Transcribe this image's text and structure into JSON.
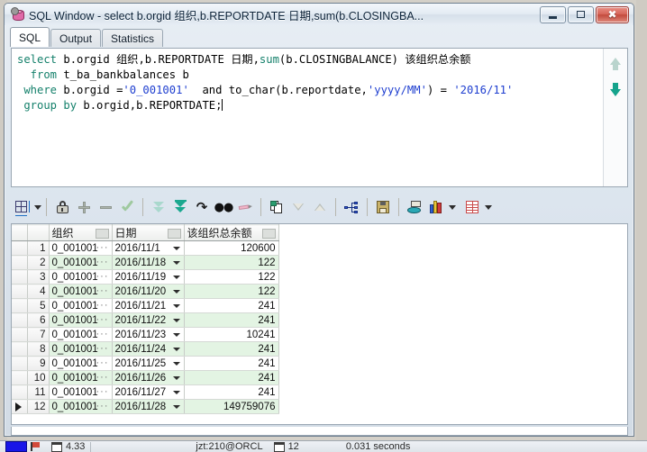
{
  "window": {
    "title": "SQL Window - select b.orgid 组织,b.REPORTDATE 日期,sum(b.CLOSINGBA...",
    "app_icon": "database-icon",
    "buttons": {
      "minimize": "minimize-icon",
      "maximize": "maximize-icon",
      "close": "close-icon"
    }
  },
  "tabs": [
    {
      "label": "SQL",
      "active": true
    },
    {
      "label": "Output",
      "active": false
    },
    {
      "label": "Statistics",
      "active": false
    }
  ],
  "editor": {
    "lines": [
      "select b.orgid 组织,b.REPORTDATE 日期,sum(b.CLOSINGBALANCE) 该组织总余额",
      "  from t_ba_bankbalances b",
      " where b.orgid ='0_001001'  and to_char(b.reportdate,'yyyy/MM') = '2016/11'",
      " group by b.orgid,b.REPORTDATE;"
    ],
    "tokens": {
      "l1_select": "select",
      "l1_a": " b.orgid ",
      "l1_cjk1": "组织",
      "l1_b": ",b.REPORTDATE ",
      "l1_cjk2": "日期",
      "l1_c": ",",
      "l1_sum": "sum",
      "l1_d": "(b.CLOSINGBALANCE) ",
      "l1_cjk3": "该组织总余额",
      "l2_from": "  from",
      "l2_a": " t_ba_bankbalances b",
      "l3_where": " where",
      "l3_a": " b.orgid =",
      "l3_s1": "'0_001001'",
      "l3_b": "  and to_char(b.reportdate,",
      "l3_s2": "'yyyy/MM'",
      "l3_c": ") = ",
      "l3_s3": "'2016/11'",
      "l4_group": " group by",
      "l4_a": " b.orgid,b.REPORTDATE;"
    },
    "scroll_up_icon": "scroll-up-arrow-icon",
    "scroll_down_icon": "scroll-down-arrow-icon"
  },
  "toolbar": {
    "items": [
      {
        "name": "grid-layout-button",
        "icon": "grid-icon",
        "has_dropdown": true,
        "enabled": true
      },
      {
        "name": "lock-record-button",
        "icon": "lock-icon",
        "enabled": true
      },
      {
        "name": "insert-record-button",
        "icon": "plus-icon",
        "enabled": false
      },
      {
        "name": "delete-record-button",
        "icon": "minus-icon",
        "enabled": false
      },
      {
        "name": "post-changes-button",
        "icon": "check-icon",
        "enabled": false
      },
      {
        "name": "fetch-all-rows-button",
        "icon": "double-down-arrow-icon",
        "enabled": false
      },
      {
        "name": "fetch-next-page-button",
        "icon": "down-to-line-icon",
        "enabled": true
      },
      {
        "name": "refresh-button",
        "icon": "redo-icon",
        "enabled": true
      },
      {
        "name": "find-button",
        "icon": "binoculars-icon",
        "enabled": true
      },
      {
        "name": "clear-filter-button",
        "icon": "eraser-icon",
        "enabled": false
      },
      {
        "name": "copy-to-clipboard-button",
        "icon": "copy-icon",
        "enabled": true
      },
      {
        "name": "sort-descending-button",
        "icon": "triangle-down-icon",
        "enabled": false
      },
      {
        "name": "sort-ascending-button",
        "icon": "triangle-up-icon",
        "enabled": false
      },
      {
        "name": "explain-plan-button",
        "icon": "plan-nodes-icon",
        "enabled": true
      },
      {
        "name": "save-results-button",
        "icon": "floppy-disk-icon",
        "enabled": true
      },
      {
        "name": "export-data-button",
        "icon": "export-disk-icon",
        "enabled": true
      },
      {
        "name": "chart-button",
        "icon": "bar-chart-icon",
        "has_dropdown": true,
        "enabled": true
      },
      {
        "name": "table-view-button",
        "icon": "red-table-icon",
        "has_dropdown": true,
        "enabled": true
      }
    ]
  },
  "grid": {
    "columns": [
      "组织",
      "日期",
      "该组织总余额"
    ],
    "rows": [
      {
        "n": "1",
        "org": "0_001001",
        "date": "2016/11/1",
        "amount": "120600",
        "selected": false
      },
      {
        "n": "2",
        "org": "0_001001",
        "date": "2016/11/18",
        "amount": "122",
        "selected": false
      },
      {
        "n": "3",
        "org": "0_001001",
        "date": "2016/11/19",
        "amount": "122",
        "selected": false
      },
      {
        "n": "4",
        "org": "0_001001",
        "date": "2016/11/20",
        "amount": "122",
        "selected": false
      },
      {
        "n": "5",
        "org": "0_001001",
        "date": "2016/11/21",
        "amount": "241",
        "selected": false
      },
      {
        "n": "6",
        "org": "0_001001",
        "date": "2016/11/22",
        "amount": "241",
        "selected": false
      },
      {
        "n": "7",
        "org": "0_001001",
        "date": "2016/11/23",
        "amount": "10241",
        "selected": false
      },
      {
        "n": "8",
        "org": "0_001001",
        "date": "2016/11/24",
        "amount": "241",
        "selected": false
      },
      {
        "n": "9",
        "org": "0_001001",
        "date": "2016/11/25",
        "amount": "241",
        "selected": false
      },
      {
        "n": "10",
        "org": "0_001001",
        "date": "2016/11/26",
        "amount": "241",
        "selected": false
      },
      {
        "n": "11",
        "org": "0_001001",
        "date": "2016/11/27",
        "amount": "241",
        "selected": false
      },
      {
        "n": "12",
        "org": "0_001001",
        "date": "2016/11/28",
        "amount": "149759076",
        "selected": true
      }
    ],
    "ellipsis": "···"
  },
  "statusbar": {
    "position": "4.33",
    "connection": "jzt:210@ORCL",
    "rows_label": "12",
    "duration": "0.031 seconds"
  },
  "colors": {
    "alt_row": "#e3f4e3",
    "keyword": "#14806b",
    "string": "#1f3fd0",
    "close_button": "#c24a3d",
    "accent": "#15a38c"
  }
}
